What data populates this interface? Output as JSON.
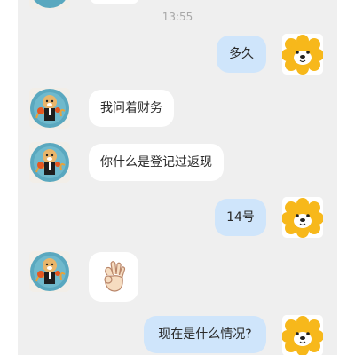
{
  "chat": {
    "timestamp": "13:55",
    "messages": [
      {
        "side": "right",
        "text": "多久",
        "avatar": "orange-lion-icon"
      },
      {
        "side": "left",
        "text": "我问着财务",
        "avatar": "agent-avatar"
      },
      {
        "side": "left",
        "text": "你什么是登记过返现",
        "avatar": "agent-avatar"
      },
      {
        "side": "right",
        "text": "14号",
        "avatar": "orange-lion-icon"
      },
      {
        "side": "left",
        "text": "",
        "sticker": "ok-hand-icon",
        "avatar": "agent-avatar"
      },
      {
        "side": "right",
        "text": "现在是什么情况?",
        "avatar": "orange-lion-icon"
      }
    ]
  },
  "colors": {
    "background": "#efefef",
    "bubble_left": "#ffffff",
    "bubble_right": "#cfe5fb",
    "lion": "#f7b81b"
  }
}
